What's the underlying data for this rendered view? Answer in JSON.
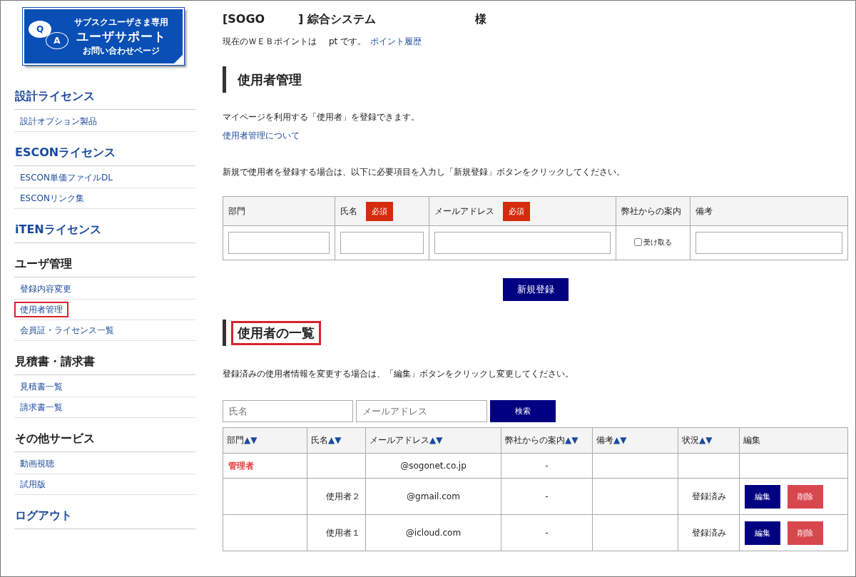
{
  "logo": {
    "q": "Q",
    "a": "A",
    "line1": "サブスクユーザさま専用",
    "line2": "ユーザサポート",
    "line3": "お問い合わせページ"
  },
  "sidebar": [
    {
      "heading": "設計ライセンス",
      "kind": "link",
      "items": [
        {
          "label": "設計オプション製品",
          "highlighted": false
        }
      ]
    },
    {
      "heading": "ESCONライセンス",
      "kind": "link",
      "items": [
        {
          "label": "ESCON単価ファイルDL",
          "highlighted": false
        },
        {
          "label": "ESCONリンク集",
          "highlighted": false
        }
      ]
    },
    {
      "heading": "iTENライセンス",
      "kind": "link"
    },
    {
      "heading": "ユーザ管理",
      "kind": "category",
      "items": [
        {
          "label": "登録内容変更",
          "highlighted": false
        },
        {
          "label": "使用者管理",
          "highlighted": true
        },
        {
          "label": "会員証・ライセンス一覧",
          "highlighted": false
        }
      ]
    },
    {
      "heading": "見積書・請求書",
      "kind": "category",
      "items": [
        {
          "label": "見積書一覧",
          "highlighted": false
        },
        {
          "label": "請求書一覧",
          "highlighted": false
        }
      ]
    },
    {
      "heading": "その他サービス",
      "kind": "category",
      "items": [
        {
          "label": "動画視聴",
          "highlighted": false
        },
        {
          "label": "試用版",
          "highlighted": false
        }
      ]
    },
    {
      "heading": "ログアウト",
      "kind": "link"
    }
  ],
  "header": {
    "company_prefix": "[SOGO",
    "company_suffix": "] 綜合システム",
    "honorific": "様",
    "points_before": "現在のＷＥＢポイントは",
    "points_after": "pt です。",
    "points_link": "ポイント履歴"
  },
  "register": {
    "heading": "使用者管理",
    "heading_highlighted": false,
    "intro": "マイページを利用する「使用者」を登録できます。",
    "about_link": "使用者管理について",
    "instruction": "新規で使用者を登録する場合は、以下に必要項目を入力し「新規登録」ボタンをクリックしてください。",
    "columns": [
      {
        "label": "部門",
        "kind": "text"
      },
      {
        "label": "氏名",
        "badge": "必須",
        "kind": "text"
      },
      {
        "label": "メールアドレス",
        "badge": "必須",
        "kind": "text"
      },
      {
        "label": "弊社からの案内",
        "kind": "checkbox",
        "option": "受け取る",
        "checked": false
      },
      {
        "label": "備考",
        "kind": "text"
      }
    ],
    "submit": "新規登録"
  },
  "list": {
    "heading": "使用者の一覧",
    "heading_highlighted": true,
    "instruction": "登録済みの使用者情報を変更する場合は、「編集」ボタンをクリックし変更してください。",
    "search": {
      "name_placeholder": "氏名",
      "email_placeholder": "メールアドレス",
      "button": "検索"
    },
    "columns": [
      {
        "label": "部門",
        "sort": "▲▼"
      },
      {
        "label": "氏名",
        "sort": "▲▼"
      },
      {
        "label": "メールアドレス",
        "sort": "▲▼"
      },
      {
        "label": "弊社からの案内",
        "sort": "▲▼"
      },
      {
        "label": "備考",
        "sort": "▲▼"
      },
      {
        "label": "状況",
        "sort": "▲▼"
      },
      {
        "label": "編集"
      }
    ],
    "rows": [
      {
        "department": "管理者",
        "color": "#e53935",
        "email": "@sogonet.co.jp",
        "guidance": "-"
      },
      {
        "name": "使用者２",
        "email": "@gmail.com",
        "guidance": "-",
        "status": "登録済み",
        "actions": [
          {
            "kind": "edit",
            "label": "編集"
          },
          {
            "kind": "delete",
            "label": "削除"
          }
        ]
      },
      {
        "name": "使用者１",
        "email": "@icloud.com",
        "guidance": "-",
        "status": "登録済み",
        "actions": [
          {
            "kind": "edit",
            "label": "編集"
          },
          {
            "kind": "delete",
            "label": "削除"
          }
        ]
      }
    ]
  }
}
